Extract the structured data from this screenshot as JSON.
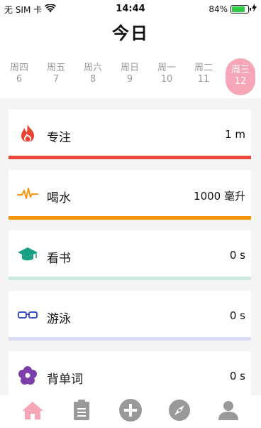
{
  "status_bar": {
    "carrier": "无 SIM 卡",
    "time": "14:44",
    "battery_percent_label": "84%",
    "battery_level": 0.84,
    "wifi_icon": "wifi-icon",
    "charging_icon": "bolt-icon"
  },
  "header": {
    "title": "今日"
  },
  "week": [
    {
      "weekday": "周四",
      "date": "6",
      "selected": false
    },
    {
      "weekday": "周五",
      "date": "7",
      "selected": false
    },
    {
      "weekday": "周六",
      "date": "8",
      "selected": false
    },
    {
      "weekday": "周日",
      "date": "9",
      "selected": false
    },
    {
      "weekday": "周一",
      "date": "10",
      "selected": false
    },
    {
      "weekday": "周二",
      "date": "11",
      "selected": false
    },
    {
      "weekday": "周三",
      "date": "12",
      "selected": true
    }
  ],
  "habits": [
    {
      "name": "专注",
      "value": "1 m",
      "icon": "flame-icon",
      "color": "#e84a3c"
    },
    {
      "name": "喝水",
      "value": "1000 毫升",
      "icon": "pulse-icon",
      "color": "#f4950c"
    },
    {
      "name": "看书",
      "value": "0 s",
      "icon": "graduation-cap-icon",
      "color": "#cde9e3"
    },
    {
      "name": "游泳",
      "value": "0 s",
      "icon": "goggles-icon",
      "color": "#d9dbf0"
    },
    {
      "name": "背单词",
      "value": "0 s",
      "icon": "flower-icon",
      "color": "#e6d6f0"
    }
  ],
  "tab_bar": {
    "items": [
      {
        "icon": "home-icon",
        "active": true
      },
      {
        "icon": "clipboard-icon",
        "active": false
      },
      {
        "icon": "add-icon",
        "active": false
      },
      {
        "icon": "compass-icon",
        "active": false
      },
      {
        "icon": "profile-icon",
        "active": false
      }
    ],
    "active_color": "#f7a6b8",
    "inactive_color": "#999999"
  }
}
